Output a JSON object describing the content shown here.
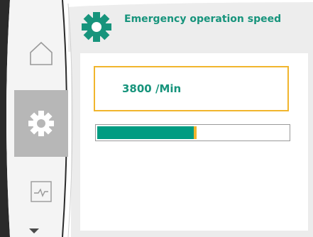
{
  "header": {
    "title": "Emergency operation speed",
    "icon": "gear-icon"
  },
  "nav": {
    "items": [
      {
        "name": "home",
        "icon": "home-icon",
        "active": false
      },
      {
        "name": "settings",
        "icon": "gear-icon",
        "active": true
      },
      {
        "name": "status",
        "icon": "trend-icon",
        "active": false
      }
    ],
    "more_icon": "chevron-down-icon"
  },
  "speed": {
    "value_label": "3800 /Min",
    "fraction": 0.5
  },
  "colors": {
    "accent_green": "#17947c",
    "bar_green": "#009c82",
    "highlight_yellow": "#f1b52d",
    "nav_active_bg": "#b7b7b7",
    "bezel_dark": "#2a2a2a",
    "bezel_light": "#f4f4f4"
  }
}
